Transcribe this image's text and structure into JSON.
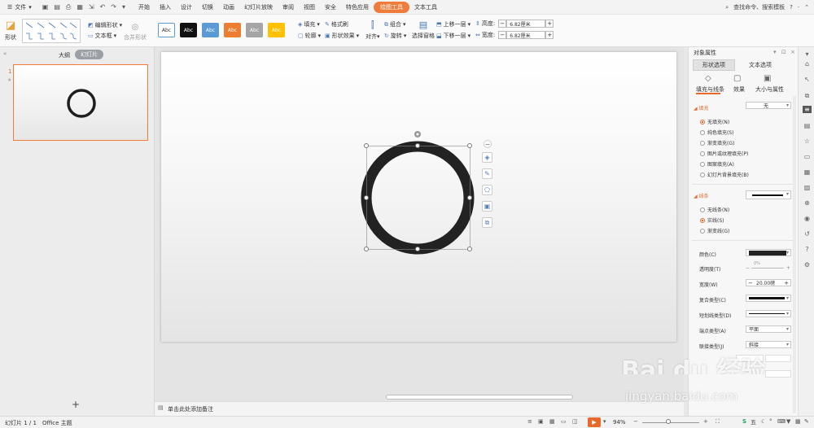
{
  "menubar": {
    "file_label": "文件",
    "tabs": [
      "开始",
      "插入",
      "设计",
      "切换",
      "动画",
      "幻灯片放映",
      "审阅",
      "视图",
      "安全",
      "特色应用",
      "绘图工具",
      "文本工具"
    ],
    "active_tab": "绘图工具",
    "search_label": "查找命令、搜索模板"
  },
  "ribbon": {
    "shape_label": "形状",
    "edit_shape": "编辑形状",
    "textbox": "文本框",
    "merge_shape": "合并形状",
    "styles": [
      "Abc",
      "Abc",
      "Abc",
      "Abc",
      "Abc",
      "Abc"
    ],
    "style_colors": [
      "#ffffff",
      "#111111",
      "#5b9bd5",
      "#ed7d31",
      "#a5a5a5",
      "#ffc000"
    ],
    "fill": "填充",
    "format_painter": "格式刷",
    "outline": "轮廓",
    "shape_effect": "形状效果",
    "align": "对齐",
    "group": "组合",
    "rotate": "旋转",
    "select_pane": "选择窗格",
    "bring_forward": "上移一层",
    "send_backward": "下移一层",
    "height_label": "高度:",
    "height_value": "6.82厘米",
    "width_label": "宽度:",
    "width_value": "6.82厘米"
  },
  "leftpane": {
    "tab_outline": "大纲",
    "tab_slides": "幻灯片",
    "slide_number": "1",
    "add_slide": "+"
  },
  "canvas": {
    "notes_placeholder": "单击此处添加备注"
  },
  "rightpane": {
    "title": "对象属性",
    "tab_shape": "形状选项",
    "tab_text": "文本选项",
    "sub_fill_line": "填充与线条",
    "sub_effect": "效果",
    "sub_size": "大小与属性",
    "fill_section": "填充",
    "fill_value": "无",
    "fill_options": [
      "无填充(N)",
      "纯色填充(S)",
      "渐变填充(G)",
      "图片或纹理填充(P)",
      "图案填充(A)",
      "幻灯片背景填充(B)"
    ],
    "line_section": "线条",
    "line_options": [
      "无线条(N)",
      "实线(S)",
      "渐变线(G)"
    ],
    "color_label": "颜色(C)",
    "transparency_label": "透明度(T)",
    "transparency_value": "0%",
    "width_label": "宽度(W)",
    "width_value": "20.00磅",
    "compound_label": "复合类型(C)",
    "dash_label": "短划线类型(D)",
    "cap_label": "端点类型(A)",
    "cap_value": "平面",
    "join_label": "联接类型(J)",
    "join_value": "斜接"
  },
  "statusbar": {
    "slide_info": "幻灯片 1 / 1",
    "theme": "Office 主题",
    "zoom": "94%",
    "lang": "五"
  },
  "watermark": {
    "text": "Bai du 经验",
    "url": "jingyan.baidu.com"
  }
}
